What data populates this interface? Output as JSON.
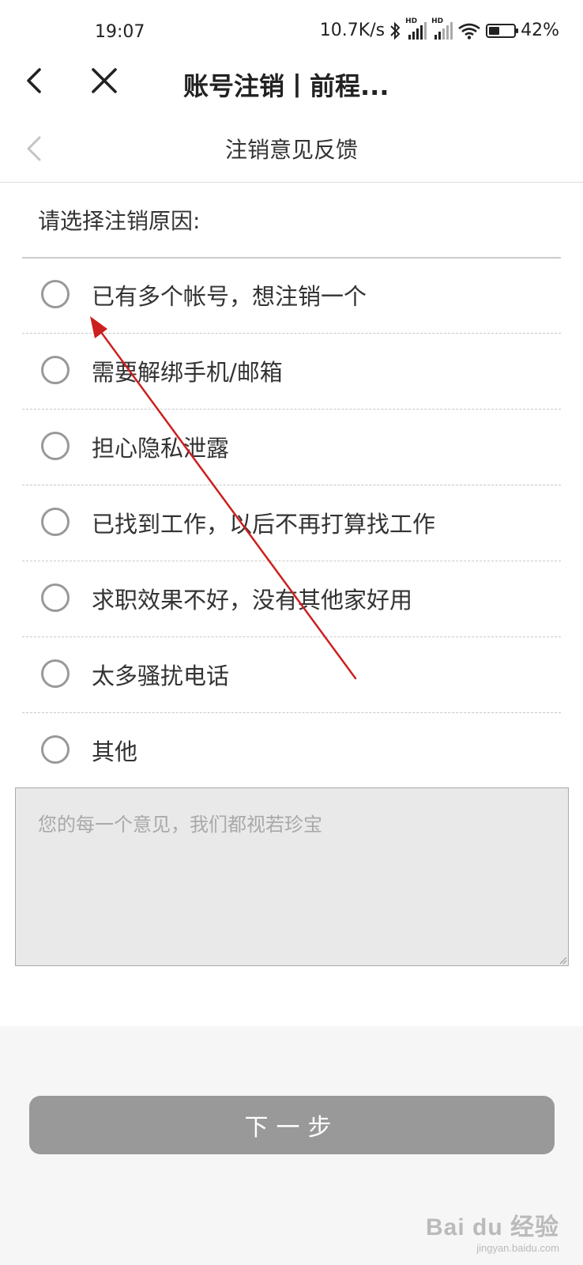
{
  "status_bar": {
    "time": "19:07",
    "network_speed": "10.7K/s",
    "sim1_label": "HD",
    "sim2_label": "HD",
    "battery_level": 42,
    "battery_text": "42%",
    "icons": [
      "bluetooth-icon",
      "signal-icon",
      "signal-icon",
      "wifi-icon",
      "battery-icon"
    ]
  },
  "app_nav": {
    "title": "账号注销丨前程...",
    "back_icon": "chevron-left-icon",
    "close_icon": "close-icon"
  },
  "sub_header": {
    "title": "注销意见反馈",
    "back_icon": "chevron-left-icon"
  },
  "form": {
    "prompt": "请选择注销原因:",
    "options": [
      {
        "label": "已有多个帐号，想注销一个",
        "checked": false
      },
      {
        "label": "需要解绑手机/邮箱",
        "checked": false
      },
      {
        "label": "担心隐私泄露",
        "checked": false
      },
      {
        "label": "已找到工作，以后不再打算找工作",
        "checked": false
      },
      {
        "label": "求职效果不好，没有其他家好用",
        "checked": false
      },
      {
        "label": "太多骚扰电话",
        "checked": false
      },
      {
        "label": "其他",
        "checked": false
      }
    ],
    "feedback_value": "",
    "feedback_placeholder": "您的每一个意见，我们都视若珍宝"
  },
  "footer": {
    "next_label": "下一步"
  },
  "watermark": {
    "logo": "Bai du 经验",
    "url": "jingyan.baidu.com"
  },
  "colors": {
    "annotation_arrow": "#cc1f1f",
    "button_bg": "#999999",
    "textarea_bg": "#e9e9e9",
    "footer_bg": "#f6f6f6"
  }
}
